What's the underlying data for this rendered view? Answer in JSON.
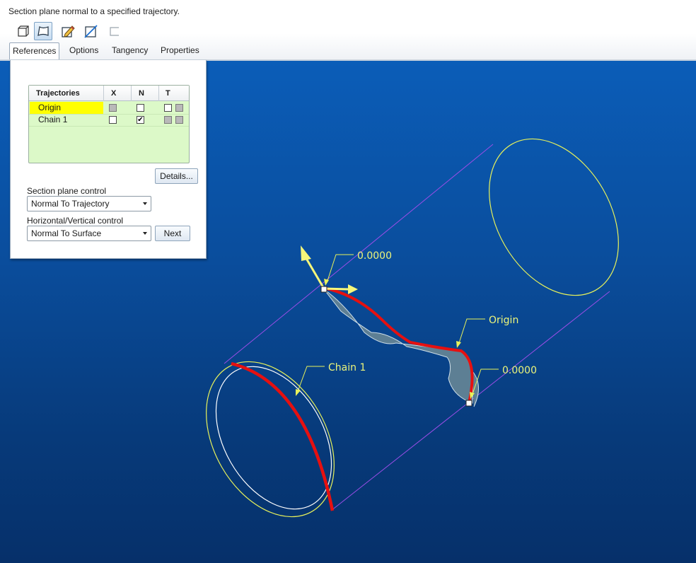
{
  "prompt": "Section plane normal to a specified trajectory.",
  "toolbar": {
    "buttons": [
      {
        "icon": "solid-icon",
        "active": false
      },
      {
        "icon": "surface-icon",
        "active": true
      },
      {
        "icon": "sketch-edit-icon",
        "active": false
      },
      {
        "icon": "remove-material-icon",
        "active": false
      },
      {
        "icon": "thicken-icon",
        "active": false
      }
    ]
  },
  "tabs": [
    "References",
    "Options",
    "Tangency",
    "Properties"
  ],
  "active_tab": "References",
  "references": {
    "table": {
      "headers": [
        "Trajectories",
        "X",
        "N",
        "T"
      ],
      "rows": [
        {
          "name": "Origin",
          "x": "grey",
          "n": false,
          "t": [
            "empty",
            "grey"
          ],
          "selected": true
        },
        {
          "name": "Chain 1",
          "x": "empty",
          "n": true,
          "t": [
            "grey",
            "grey"
          ],
          "selected": false
        }
      ]
    },
    "details_label": "Details...",
    "section_plane_label": "Section plane control",
    "section_plane_value": "Normal To Trajectory",
    "hv_label": "Horizontal/Vertical control",
    "hv_value": "Normal To Surface",
    "next_label": "Next"
  },
  "viewport": {
    "labels": {
      "top_value": "0.0000",
      "origin": "Origin",
      "right_value": "0.0000",
      "chain": "Chain 1"
    },
    "colors": {
      "background": "#0a4d9c",
      "trajectory": "#e61010",
      "outline": "#e8f25a",
      "construction": "#9a4de6",
      "surface": "#5d7f94",
      "arrow": "#f6f77a"
    }
  }
}
